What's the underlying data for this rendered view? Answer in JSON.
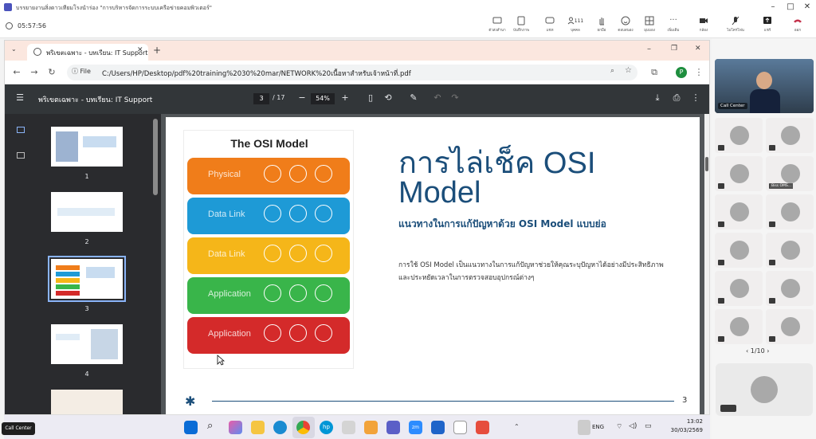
{
  "meeting": {
    "title": "บรรยายงานสิ่งดาวเทียมโรงนำร่อง \"การบริหารจัดการระบบเครือข่ายคอมพิวเตอร์\"",
    "timer": "05:57:56",
    "toolbar": [
      {
        "label": "ตัวส่งสำนา",
        "icon": "share-icon"
      },
      {
        "label": "บันทึกภาพ",
        "icon": "record-icon"
      },
      {
        "label": "แชท",
        "icon": "chat-icon"
      },
      {
        "label": "บุคคล",
        "icon": "people-icon"
      },
      {
        "label": "ยกมือ",
        "icon": "raise-hand-icon"
      },
      {
        "label": "ตอบสนอง",
        "icon": "react-icon"
      },
      {
        "label": "มุมมอง",
        "icon": "view-icon"
      },
      {
        "label": "เพิ่มเติม",
        "icon": "more-icon"
      },
      {
        "label": "กล้อง",
        "icon": "camera-off-icon"
      },
      {
        "label": "ไมโครโฟน",
        "icon": "mic-off-icon"
      },
      {
        "label": "แชร์",
        "icon": "share-screen-icon"
      },
      {
        "label": "ออก",
        "icon": "leave-icon"
      }
    ],
    "participant_count": "111"
  },
  "browser": {
    "tab_title": "พริเขตเฉพาะ - บทเรียน: IT Support",
    "url_chip": "File",
    "url": "C:/Users/HP/Desktop/pdf%20training%2030%20mar/NETWORK%20เนื้อหาสำหรับเจ้าหน้าที่.pdf",
    "profile_letter": "P"
  },
  "pdf": {
    "title": "พริเขตเฉพาะ - บทเรียน: IT Support",
    "page_current": "3",
    "page_total": "/ 17",
    "zoom": "54%",
    "thumbnails": [
      "1",
      "2",
      "3",
      "4"
    ]
  },
  "slide": {
    "card_title": "The OSI Model",
    "layers": [
      "Physical",
      "Data Link",
      "Data Link",
      "Application",
      "Application"
    ],
    "heading_line1": "การไล่เช็ค OSI",
    "heading_line2": "Model",
    "subheading": "แนวทางในการแก้ปัญหาด้วย OSI Model แบบย่อ",
    "body_line1": "การใช้ OSI Model เป็นแนวทางในการแก้ปัญหาช่วยให้คุณระบุปัญหาได้อย่างมีประสิทธิภาพ",
    "body_line2": "และประหยัดเวลาในการตรวจสอบอุปกรณ์ต่างๆ",
    "page_number": "3"
  },
  "taskbar": {
    "lang": "ENG",
    "time": "13:02",
    "date": "30/03/2569",
    "call_center": "Call Center"
  },
  "panel": {
    "host_name": "Call Center",
    "tile_label": "Biss OMS...",
    "pager": "1/10"
  },
  "colors": {
    "layer_colors": [
      "#f07d1a",
      "#1e9ad6",
      "#f5b619",
      "#39b54a",
      "#d42a2a"
    ],
    "heading": "#1b4e7a"
  }
}
